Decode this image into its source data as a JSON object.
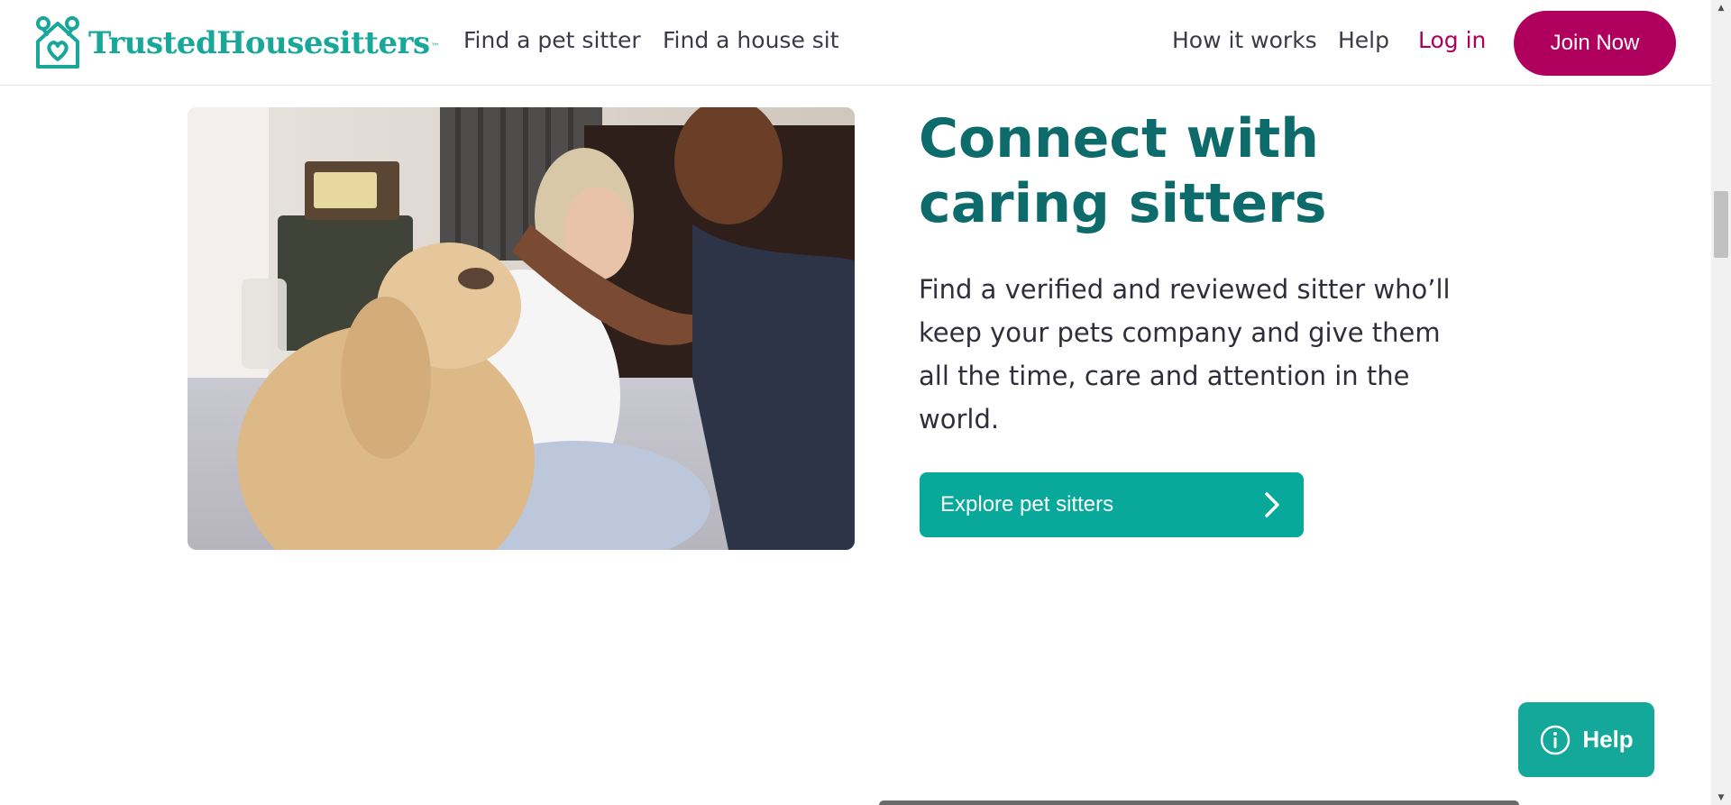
{
  "header": {
    "logo_text": "TrustedHousesitters",
    "logo_tm": "™",
    "nav": {
      "find_pet_sitter": "Find a pet sitter",
      "find_house_sit": "Find a house sit",
      "how_it_works": "How it works",
      "help": "Help",
      "log_in": "Log in"
    },
    "join_label": "Join Now"
  },
  "main": {
    "headline": "Connect with caring sitters",
    "body": "Find a verified and reviewed sitter who’ll keep your pets company and give them all the time, care and attention in the world.",
    "explore_label": "Explore pet sitters"
  },
  "help_widget": {
    "label": "Help"
  },
  "colors": {
    "brand_teal": "#17a89a",
    "headline_teal": "#0e6b6b",
    "button_teal": "#08a89a",
    "join_magenta": "#b0005e"
  },
  "icons": {
    "logo": "house-heart-icon",
    "explore": "chevron-right-icon",
    "help": "info-circle-icon"
  }
}
